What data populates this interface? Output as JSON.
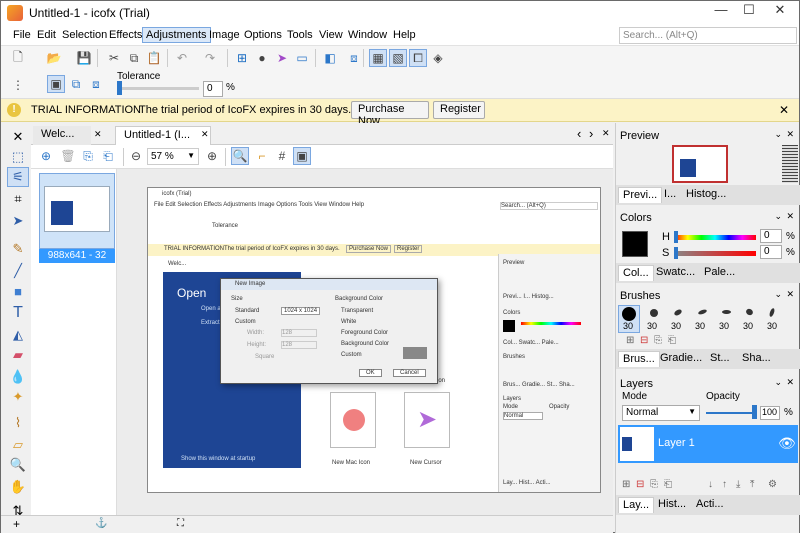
{
  "window": {
    "title": "Untitled-1 - icofx (Trial)",
    "min": "—",
    "max": "☐",
    "close": "✕"
  },
  "menu": {
    "items": [
      "File",
      "Edit",
      "Selection",
      "Effects",
      "Adjustments",
      "Image",
      "Options",
      "Tools",
      "View",
      "Window",
      "Help"
    ],
    "active": "Adjustments",
    "search_placeholder": "Search... (Alt+Q)"
  },
  "toolbar2": {
    "tolerance_label": "Tolerance",
    "tolerance_value": "0",
    "tolerance_unit": "%",
    "tolerance_level": 0
  },
  "trial": {
    "title": "TRIAL INFORMATION",
    "message": "The trial period of IcoFX expires in 30 days.",
    "purchase": "Purchase Now",
    "register": "Register",
    "close": "✕"
  },
  "tabs": [
    {
      "label": "Welc...",
      "close": "✕"
    },
    {
      "label": "Untitled-1 (I...",
      "close": "✕"
    }
  ],
  "tab_nav": {
    "prev": "‹",
    "next": "›",
    "close": "✕"
  },
  "doc": {
    "zoom": "57 %",
    "thumb_label": "988x641 - 32"
  },
  "panels": {
    "preview": {
      "title": "Preview",
      "tabs": [
        "Previ...",
        "I...",
        "Histog..."
      ]
    },
    "colors": {
      "title": "Colors",
      "h_label": "H",
      "h_value": "0",
      "s_label": "S",
      "s_value": "0",
      "unit": "%",
      "tabs": [
        "Col...",
        "Swatc...",
        "Pale..."
      ],
      "primary": "#000000"
    },
    "brushes": {
      "title": "Brushes",
      "sizes": [
        "30",
        "30",
        "30",
        "30",
        "30",
        "30",
        "30"
      ],
      "tabs": [
        "Brus...",
        "Gradie...",
        "St...",
        "Sha..."
      ]
    },
    "layers": {
      "title": "Layers",
      "mode_label": "Mode",
      "opacity_label": "Opacity",
      "mode_value": "Normal",
      "opacity_value": "100",
      "opacity_unit": "%",
      "opacity_level": 100,
      "layer_name": "Layer 1",
      "tabs": [
        "Lay...",
        "Hist...",
        "Acti..."
      ]
    }
  },
  "mini": {
    "title": "icofx (Trial)",
    "menu": "File  Edit  Selection  Effects  Adjustments  Image  Options  Tools  View  Window  Help",
    "search": "Search... (Alt+Q)",
    "tolerance": "Tolerance",
    "trial_title": "TRIAL INFORMATION",
    "trial_msg": "The trial period of IcoFX expires in 30 days.",
    "purchase": "Purchase Now",
    "register": "Register",
    "tab_welcome": "Welc...",
    "preview": "Preview",
    "preview_tabs": "Previ...   I...   Histog...",
    "colors": "Colors",
    "colors_tabs": "Col...  Swatc...  Pale...",
    "brushes": "Brushes",
    "brushes_tabs": "Brus...  Gradie...  St...  Sha...",
    "layers": "Layers",
    "mode": "Mode",
    "opacity": "Opacity",
    "normal": "Normal",
    "layers_tabs": "Lay...   Hist...   Acti...",
    "open": "Open",
    "open1": "Open a",
    "open2": "Extract",
    "show_startup": "Show this window at startup",
    "icon_label_1": "icon",
    "new_mac_icon": "New Mac Icon",
    "new_cursor": "New Cursor",
    "dialog": {
      "title": "New Image",
      "size": "Size",
      "standard": "Standard",
      "standard_value": "1024 x 1024",
      "custom": "Custom",
      "width": "Width:",
      "width_value": "128",
      "height": "Height:",
      "height_value": "128",
      "square": "Square",
      "bg_title": "Background Color",
      "bg_options": [
        "Transparent",
        "White",
        "Foreground Color",
        "Background Color",
        "Custom"
      ],
      "ok": "OK",
      "cancel": "Cancel"
    }
  },
  "status": {
    "add": "+",
    "anchor": "⚓",
    "frame": "⛶"
  },
  "colors": {
    "accent": "#3399ff",
    "trial_bg": "#fcf3c6",
    "mini_blue": "#1e4594",
    "layer_bg": "#3399ff"
  }
}
